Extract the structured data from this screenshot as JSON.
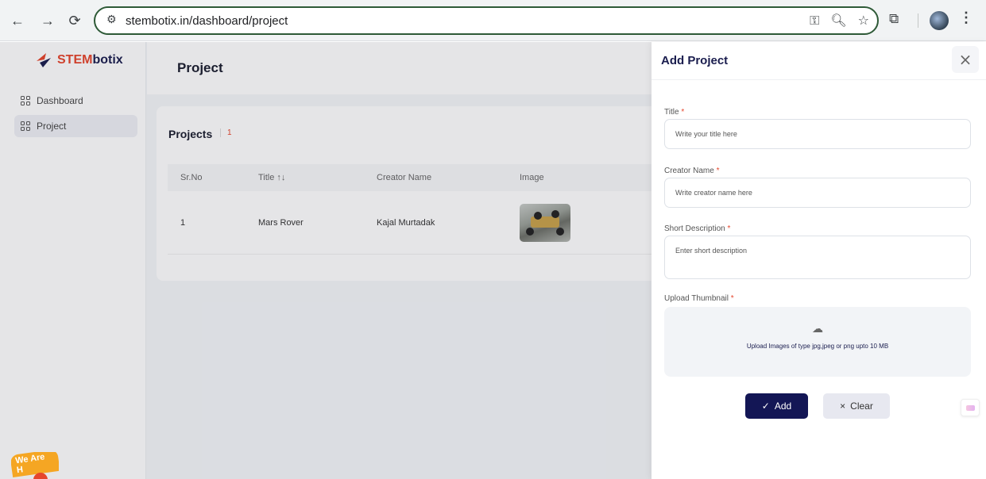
{
  "browser": {
    "url": "stembotix.in/dashboard/project",
    "icons": [
      "back-icon",
      "forward-icon",
      "reload-icon",
      "site-info-icon",
      "password-key-icon",
      "zoom-icon",
      "bookmark-star-icon",
      "extensions-icon",
      "profile-avatar",
      "kebab-menu-icon"
    ]
  },
  "sidebar": {
    "logo": {
      "stem": "STEM",
      "botix": "botix"
    },
    "items": [
      {
        "label": "Dashboard",
        "icon": "grid-icon"
      },
      {
        "label": "Project",
        "icon": "grid-icon",
        "active": true
      }
    ]
  },
  "header": {
    "title": "Project"
  },
  "projects": {
    "title": "Projects",
    "count": "1",
    "columns": [
      "Sr.No",
      "Title ↑↓",
      "Creator Name",
      "Image"
    ],
    "rows": [
      {
        "sr": "1",
        "title": "Mars Rover",
        "creator": "Kajal Murtadak"
      }
    ]
  },
  "badge": {
    "text": "We Are H"
  },
  "drawer": {
    "title": "Add Project",
    "fields": {
      "title": {
        "label": "Title",
        "placeholder": "Write your title here",
        "value": ""
      },
      "creator": {
        "label": "Creator Name",
        "placeholder": "Write creator name here",
        "value": ""
      },
      "short_desc": {
        "label": "Short Description",
        "placeholder": "Enter short description",
        "value": ""
      },
      "thumbnail": {
        "label": "Upload Thumbnail",
        "hint": "Upload Images of type jpg,jpeg or png upto 10 MB"
      }
    },
    "required_mark": "*",
    "add_label": "Add",
    "clear_label": "Clear"
  },
  "colors": {
    "primary": "#131655",
    "accent": "#e6452c",
    "omnibox_border": "#2e5a37"
  }
}
